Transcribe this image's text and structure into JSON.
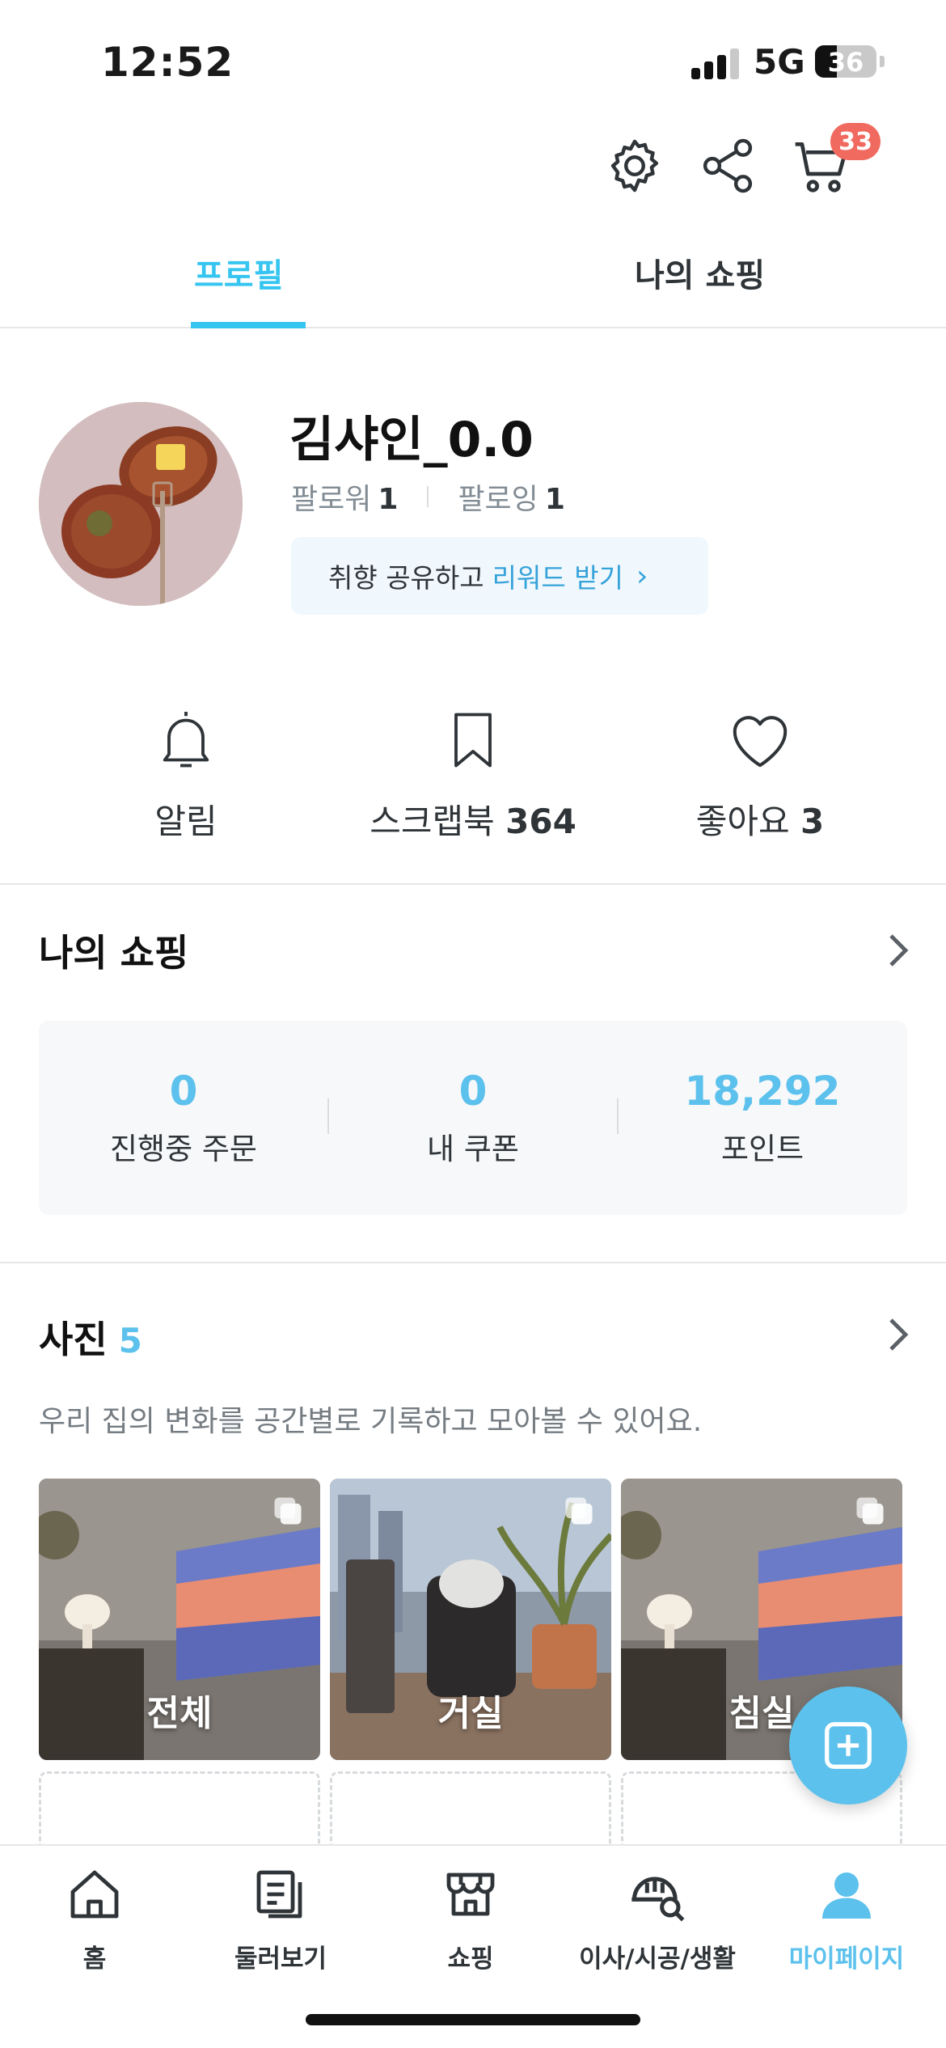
{
  "status_bar": {
    "time": "12:52",
    "network": "5G",
    "battery": "36",
    "battery_level": 0.36
  },
  "header": {
    "cart_count": "33",
    "icons": [
      "gear-icon",
      "share-icon",
      "cart-icon"
    ]
  },
  "tabs": [
    {
      "label": "프로필",
      "active": true
    },
    {
      "label": "나의 쇼핑",
      "active": false
    }
  ],
  "profile": {
    "username": "김샤인_0.0",
    "followers_label": "팔로워",
    "followers": "1",
    "following_label": "팔로잉",
    "following": "1",
    "reward_text": "취향 공유하고",
    "reward_highlight": "리워드 받기",
    "reward_chevron": "›"
  },
  "quick_actions": [
    {
      "label": "알림",
      "count": "",
      "icon": "bell-icon"
    },
    {
      "label": "스크랩북",
      "count": "364",
      "icon": "bookmark-icon"
    },
    {
      "label": "좋아요",
      "count": "3",
      "icon": "heart-icon"
    }
  ],
  "my_shopping": {
    "title": "나의 쇼핑",
    "stats": [
      {
        "value": "0",
        "label": "진행중 주문"
      },
      {
        "value": "0",
        "label": "내 쿠폰"
      },
      {
        "value": "18,292",
        "label": "포인트"
      }
    ]
  },
  "photos": {
    "title": "사진",
    "count": "5",
    "description": "우리 집의 변화를 공간별로 기록하고 모아볼 수 있어요.",
    "items": [
      {
        "label": "전체"
      },
      {
        "label": "거실"
      },
      {
        "label": "침실"
      }
    ]
  },
  "bottom_nav": [
    {
      "label": "홈",
      "icon": "home-icon",
      "active": false
    },
    {
      "label": "둘러보기",
      "icon": "browse-icon",
      "active": false
    },
    {
      "label": "쇼핑",
      "icon": "store-icon",
      "active": false
    },
    {
      "label": "이사/시공/생활",
      "icon": "helmet-search-icon",
      "active": false
    },
    {
      "label": "마이페이지",
      "icon": "person-icon",
      "active": true
    }
  ],
  "colors": {
    "accent": "#35c5f0",
    "point_blue": "#5cc1ec",
    "badge_red": "#f06a5f"
  }
}
